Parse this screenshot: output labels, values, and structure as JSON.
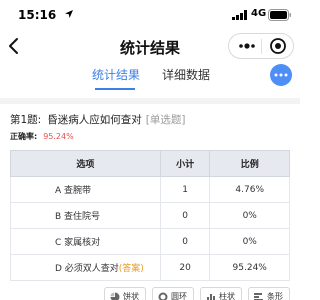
{
  "status_bar": {
    "time": "15:16",
    "network": "4G",
    "icons": [
      "location-arrow-icon",
      "signal-icon",
      "battery-icon"
    ]
  },
  "nav": {
    "title": "统计结果",
    "icons": [
      "back-icon",
      "more-dots-icon",
      "close-circle-icon"
    ]
  },
  "tabs": [
    {
      "label": "统计结果",
      "active": true
    },
    {
      "label": "详细数据",
      "active": false
    }
  ],
  "question": {
    "number": "第1题:",
    "text": "昏迷病人应如何查对",
    "type": "[单选题]",
    "accuracy_label": "正确率:",
    "accuracy_value": "95.24%"
  },
  "table": {
    "headers": [
      "选项",
      "小计",
      "比例"
    ],
    "rows": [
      {
        "option": "A 查腕带",
        "count": "1",
        "ratio": "4.76%",
        "tag": ""
      },
      {
        "option": "B 查住院号",
        "count": "0",
        "ratio": "0%",
        "tag": ""
      },
      {
        "option": "C 家属核对",
        "count": "0",
        "ratio": "0%",
        "tag": ""
      },
      {
        "option": "D 必须双人查对",
        "count": "20",
        "ratio": "95.24%",
        "tag": "(答案)"
      }
    ]
  },
  "chart_buttons": [
    {
      "label": "饼状",
      "icon": "pie-chart-icon"
    },
    {
      "label": "圆环",
      "icon": "donut-chart-icon"
    },
    {
      "label": "柱状",
      "icon": "bar-chart-icon"
    },
    {
      "label": "条形",
      "icon": "horizontal-bar-chart-icon"
    }
  ],
  "colors": {
    "accent": "#3d7fe6",
    "fab": "#4d8ef7",
    "accuracy": "#e3534f",
    "answer_tag": "#e89b24",
    "table_header_bg": "#e6e9ef"
  }
}
